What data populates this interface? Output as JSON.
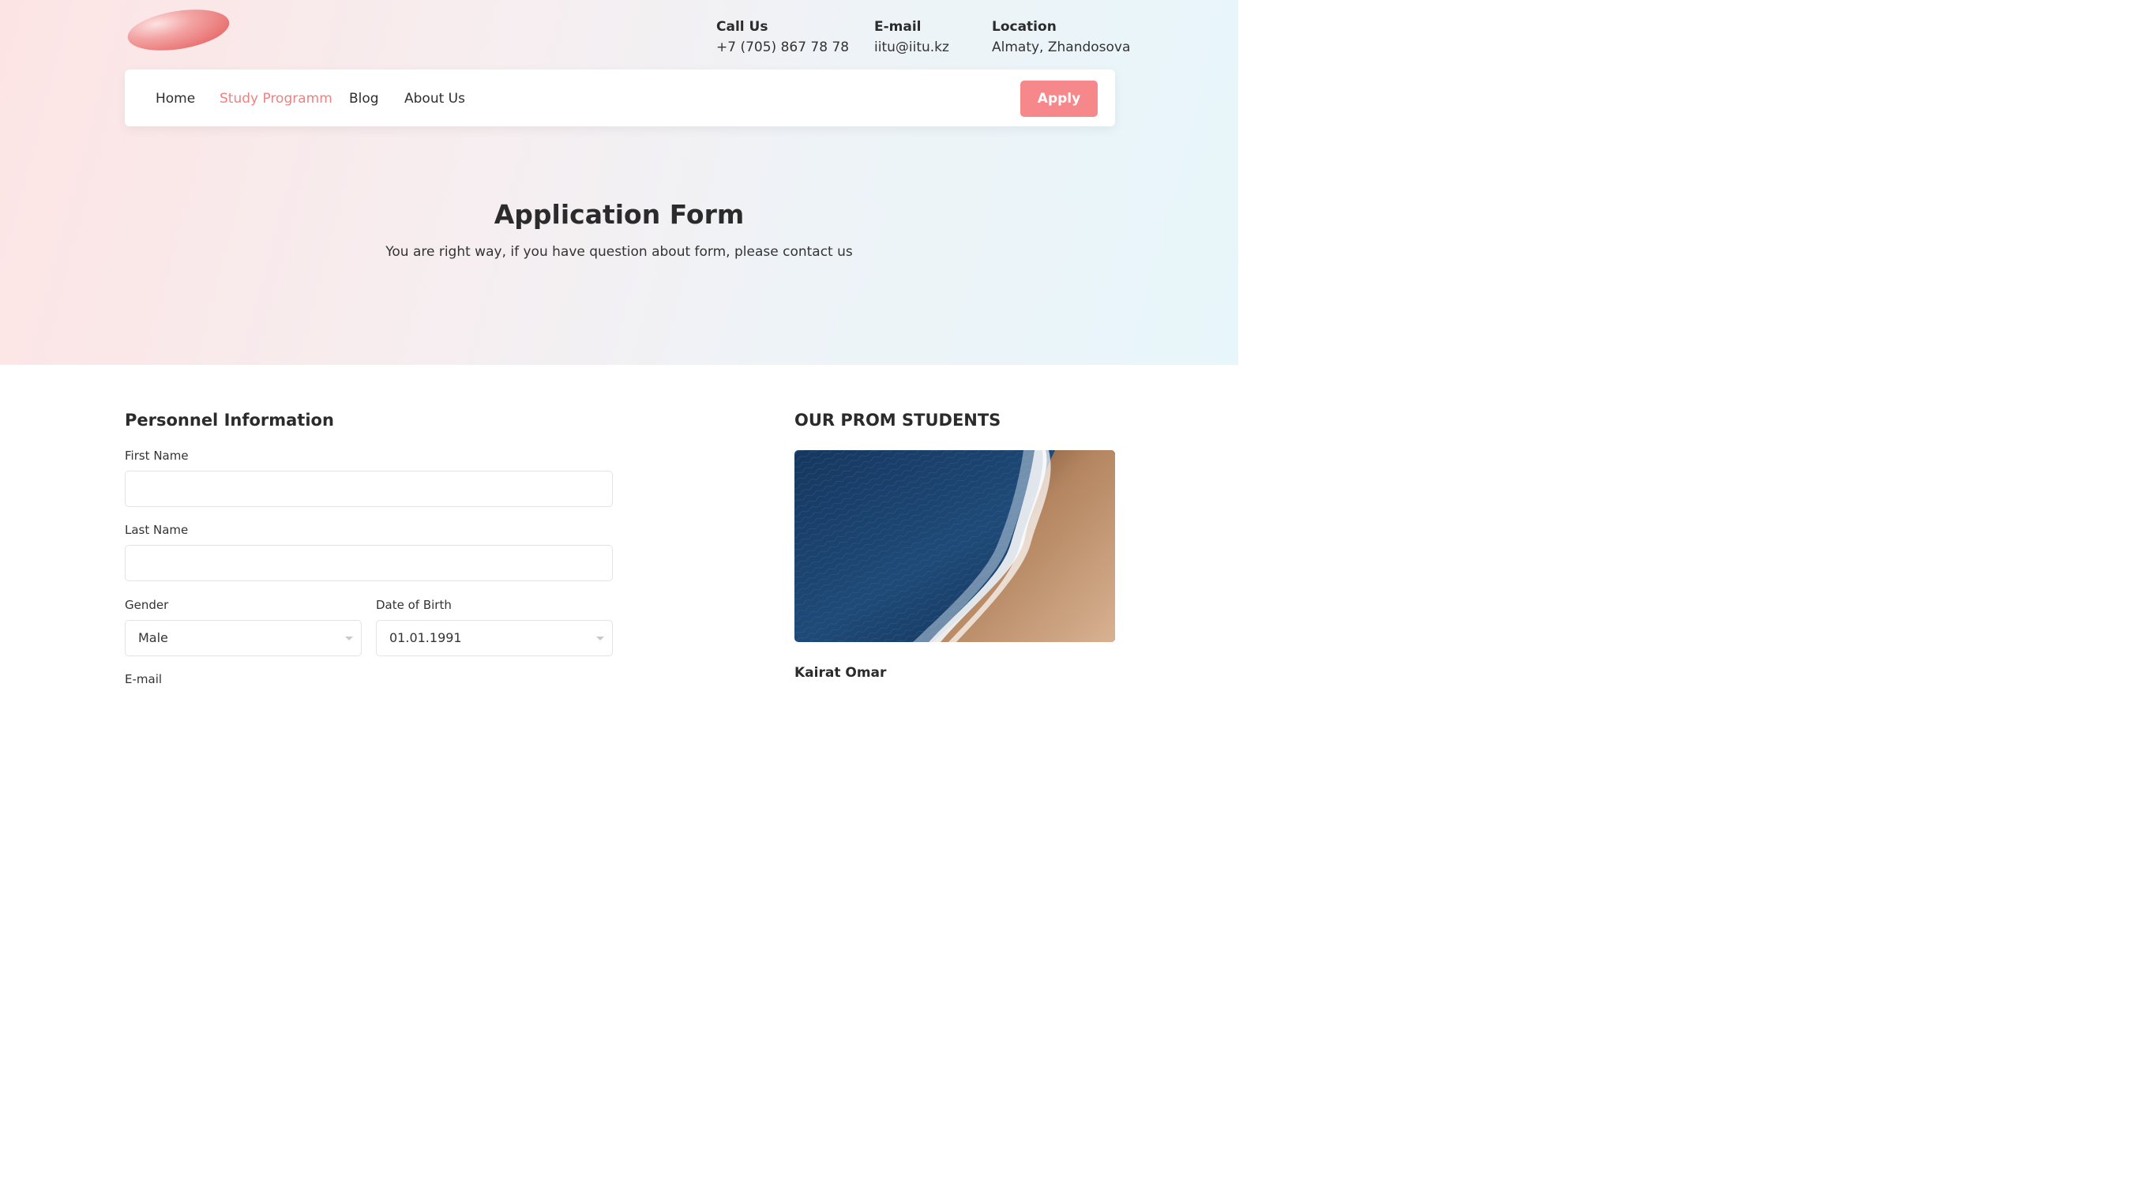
{
  "header": {
    "contacts": [
      {
        "label": "Call Us",
        "value": "+7 (705) 867 78 78"
      },
      {
        "label": "E-mail",
        "value": "iitu@iitu.kz"
      },
      {
        "label": "Location",
        "value": "Almaty, Zhandosova"
      }
    ]
  },
  "nav": {
    "items": [
      {
        "label": "Home",
        "active": false
      },
      {
        "label": "Study Programm",
        "active": true
      },
      {
        "label": "Blog",
        "active": false
      },
      {
        "label": "About Us",
        "active": false
      }
    ],
    "apply_label": "Apply"
  },
  "hero": {
    "title": "Application Form",
    "subtitle": "You are right way, if you have question about form, please contact us"
  },
  "form": {
    "section_title": "Personnel Information",
    "first_name": {
      "label": "First Name",
      "value": ""
    },
    "last_name": {
      "label": "Last Name",
      "value": ""
    },
    "gender": {
      "label": "Gender",
      "value": "Male"
    },
    "dob": {
      "label": "Date of Birth",
      "value": "01.01.1991"
    },
    "email": {
      "label": "E-mail"
    }
  },
  "sidebar": {
    "title": "OUR PROM STUDENTS",
    "student_name": "Kairat Omar"
  },
  "colors": {
    "accent": "#f6878a",
    "active_nav": "#f28080"
  }
}
